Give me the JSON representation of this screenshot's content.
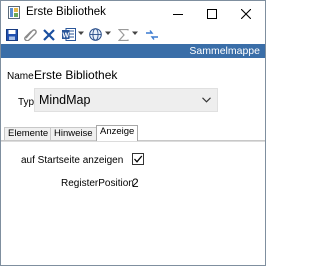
{
  "window": {
    "title": "Erste Bibliothek"
  },
  "toolbar": {
    "icons": [
      "save-icon",
      "attach-icon",
      "delete-icon",
      "word-export-icon",
      "globe-icon",
      "sum-icon",
      "link-icon"
    ]
  },
  "header": {
    "section": "Sammelmappe"
  },
  "form": {
    "name_label": "Name",
    "name_value": "Erste Bibliothek",
    "type_label": "Typ",
    "type_value": "MindMap"
  },
  "tabs": [
    {
      "label": "Elemente",
      "active": false
    },
    {
      "label": "Hinweise",
      "active": false
    },
    {
      "label": "Anzeige",
      "active": true
    }
  ],
  "panel": {
    "show_on_start_label": "auf Startseite anzeigen",
    "show_on_start_checked": true,
    "register_label": "RegisterPosition",
    "register_value": "2"
  },
  "colors": {
    "strip": "#3a6ea8",
    "delete": "#1a4fa0",
    "save": "#2050b0"
  }
}
